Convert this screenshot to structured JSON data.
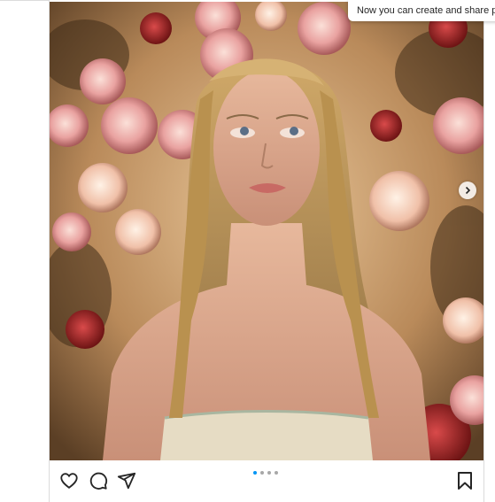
{
  "toast": {
    "text": "Now you can create and share p"
  },
  "post": {
    "carousel": {
      "slide_count": 4,
      "active_index": 0
    },
    "actions": {
      "like_icon": "heart-icon",
      "comment_icon": "comment-icon",
      "share_icon": "paper-plane-icon",
      "save_icon": "bookmark-icon",
      "next_icon": "chevron-right-icon"
    },
    "colors": {
      "active_dot": "#0095f6",
      "inactive_dot": "#a8a8a8"
    }
  }
}
